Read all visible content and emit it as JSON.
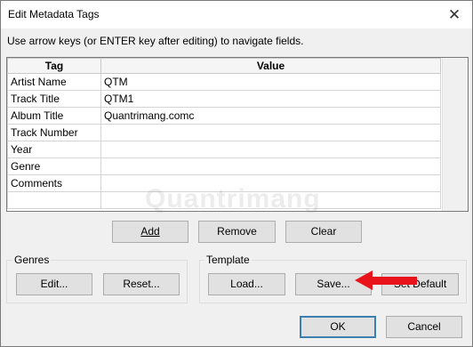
{
  "window": {
    "title": "Edit Metadata Tags",
    "close_glyph": "✕"
  },
  "hint": "Use arrow keys (or ENTER key after editing) to navigate fields.",
  "table": {
    "headers": [
      "Tag",
      "Value"
    ],
    "rows": [
      [
        "Artist Name",
        "QTM"
      ],
      [
        "Track Title",
        "QTM1"
      ],
      [
        "Album Title",
        "Quantrimang.comc"
      ],
      [
        "Track Number",
        ""
      ],
      [
        "Year",
        ""
      ],
      [
        "Genre",
        ""
      ],
      [
        "Comments",
        ""
      ],
      [
        "",
        ""
      ]
    ]
  },
  "buttons": {
    "add": "Add",
    "remove": "Remove",
    "clear": "Clear"
  },
  "genres": {
    "label": "Genres",
    "edit": "Edit...",
    "reset": "Reset..."
  },
  "template": {
    "label": "Template",
    "load": "Load...",
    "save": "Save...",
    "set_default": "Set Default"
  },
  "footer": {
    "ok": "OK",
    "cancel": "Cancel"
  },
  "watermark": "Quantrimang",
  "colors": {
    "arrow": "#e8131b",
    "default_button_border": "#3c7fb1"
  }
}
